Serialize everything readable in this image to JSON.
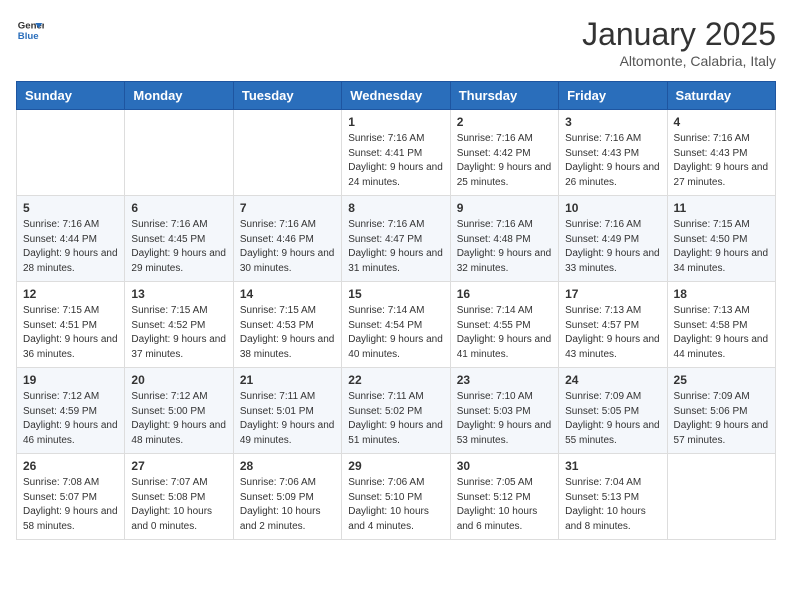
{
  "logo": {
    "line1": "General",
    "line2": "Blue"
  },
  "title": "January 2025",
  "subtitle": "Altomonte, Calabria, Italy",
  "weekdays": [
    "Sunday",
    "Monday",
    "Tuesday",
    "Wednesday",
    "Thursday",
    "Friday",
    "Saturday"
  ],
  "weeks": [
    [
      {
        "day": "",
        "sunrise": "",
        "sunset": "",
        "daylight": ""
      },
      {
        "day": "",
        "sunrise": "",
        "sunset": "",
        "daylight": ""
      },
      {
        "day": "",
        "sunrise": "",
        "sunset": "",
        "daylight": ""
      },
      {
        "day": "1",
        "sunrise": "Sunrise: 7:16 AM",
        "sunset": "Sunset: 4:41 PM",
        "daylight": "Daylight: 9 hours and 24 minutes."
      },
      {
        "day": "2",
        "sunrise": "Sunrise: 7:16 AM",
        "sunset": "Sunset: 4:42 PM",
        "daylight": "Daylight: 9 hours and 25 minutes."
      },
      {
        "day": "3",
        "sunrise": "Sunrise: 7:16 AM",
        "sunset": "Sunset: 4:43 PM",
        "daylight": "Daylight: 9 hours and 26 minutes."
      },
      {
        "day": "4",
        "sunrise": "Sunrise: 7:16 AM",
        "sunset": "Sunset: 4:43 PM",
        "daylight": "Daylight: 9 hours and 27 minutes."
      }
    ],
    [
      {
        "day": "5",
        "sunrise": "Sunrise: 7:16 AM",
        "sunset": "Sunset: 4:44 PM",
        "daylight": "Daylight: 9 hours and 28 minutes."
      },
      {
        "day": "6",
        "sunrise": "Sunrise: 7:16 AM",
        "sunset": "Sunset: 4:45 PM",
        "daylight": "Daylight: 9 hours and 29 minutes."
      },
      {
        "day": "7",
        "sunrise": "Sunrise: 7:16 AM",
        "sunset": "Sunset: 4:46 PM",
        "daylight": "Daylight: 9 hours and 30 minutes."
      },
      {
        "day": "8",
        "sunrise": "Sunrise: 7:16 AM",
        "sunset": "Sunset: 4:47 PM",
        "daylight": "Daylight: 9 hours and 31 minutes."
      },
      {
        "day": "9",
        "sunrise": "Sunrise: 7:16 AM",
        "sunset": "Sunset: 4:48 PM",
        "daylight": "Daylight: 9 hours and 32 minutes."
      },
      {
        "day": "10",
        "sunrise": "Sunrise: 7:16 AM",
        "sunset": "Sunset: 4:49 PM",
        "daylight": "Daylight: 9 hours and 33 minutes."
      },
      {
        "day": "11",
        "sunrise": "Sunrise: 7:15 AM",
        "sunset": "Sunset: 4:50 PM",
        "daylight": "Daylight: 9 hours and 34 minutes."
      }
    ],
    [
      {
        "day": "12",
        "sunrise": "Sunrise: 7:15 AM",
        "sunset": "Sunset: 4:51 PM",
        "daylight": "Daylight: 9 hours and 36 minutes."
      },
      {
        "day": "13",
        "sunrise": "Sunrise: 7:15 AM",
        "sunset": "Sunset: 4:52 PM",
        "daylight": "Daylight: 9 hours and 37 minutes."
      },
      {
        "day": "14",
        "sunrise": "Sunrise: 7:15 AM",
        "sunset": "Sunset: 4:53 PM",
        "daylight": "Daylight: 9 hours and 38 minutes."
      },
      {
        "day": "15",
        "sunrise": "Sunrise: 7:14 AM",
        "sunset": "Sunset: 4:54 PM",
        "daylight": "Daylight: 9 hours and 40 minutes."
      },
      {
        "day": "16",
        "sunrise": "Sunrise: 7:14 AM",
        "sunset": "Sunset: 4:55 PM",
        "daylight": "Daylight: 9 hours and 41 minutes."
      },
      {
        "day": "17",
        "sunrise": "Sunrise: 7:13 AM",
        "sunset": "Sunset: 4:57 PM",
        "daylight": "Daylight: 9 hours and 43 minutes."
      },
      {
        "day": "18",
        "sunrise": "Sunrise: 7:13 AM",
        "sunset": "Sunset: 4:58 PM",
        "daylight": "Daylight: 9 hours and 44 minutes."
      }
    ],
    [
      {
        "day": "19",
        "sunrise": "Sunrise: 7:12 AM",
        "sunset": "Sunset: 4:59 PM",
        "daylight": "Daylight: 9 hours and 46 minutes."
      },
      {
        "day": "20",
        "sunrise": "Sunrise: 7:12 AM",
        "sunset": "Sunset: 5:00 PM",
        "daylight": "Daylight: 9 hours and 48 minutes."
      },
      {
        "day": "21",
        "sunrise": "Sunrise: 7:11 AM",
        "sunset": "Sunset: 5:01 PM",
        "daylight": "Daylight: 9 hours and 49 minutes."
      },
      {
        "day": "22",
        "sunrise": "Sunrise: 7:11 AM",
        "sunset": "Sunset: 5:02 PM",
        "daylight": "Daylight: 9 hours and 51 minutes."
      },
      {
        "day": "23",
        "sunrise": "Sunrise: 7:10 AM",
        "sunset": "Sunset: 5:03 PM",
        "daylight": "Daylight: 9 hours and 53 minutes."
      },
      {
        "day": "24",
        "sunrise": "Sunrise: 7:09 AM",
        "sunset": "Sunset: 5:05 PM",
        "daylight": "Daylight: 9 hours and 55 minutes."
      },
      {
        "day": "25",
        "sunrise": "Sunrise: 7:09 AM",
        "sunset": "Sunset: 5:06 PM",
        "daylight": "Daylight: 9 hours and 57 minutes."
      }
    ],
    [
      {
        "day": "26",
        "sunrise": "Sunrise: 7:08 AM",
        "sunset": "Sunset: 5:07 PM",
        "daylight": "Daylight: 9 hours and 58 minutes."
      },
      {
        "day": "27",
        "sunrise": "Sunrise: 7:07 AM",
        "sunset": "Sunset: 5:08 PM",
        "daylight": "Daylight: 10 hours and 0 minutes."
      },
      {
        "day": "28",
        "sunrise": "Sunrise: 7:06 AM",
        "sunset": "Sunset: 5:09 PM",
        "daylight": "Daylight: 10 hours and 2 minutes."
      },
      {
        "day": "29",
        "sunrise": "Sunrise: 7:06 AM",
        "sunset": "Sunset: 5:10 PM",
        "daylight": "Daylight: 10 hours and 4 minutes."
      },
      {
        "day": "30",
        "sunrise": "Sunrise: 7:05 AM",
        "sunset": "Sunset: 5:12 PM",
        "daylight": "Daylight: 10 hours and 6 minutes."
      },
      {
        "day": "31",
        "sunrise": "Sunrise: 7:04 AM",
        "sunset": "Sunset: 5:13 PM",
        "daylight": "Daylight: 10 hours and 8 minutes."
      },
      {
        "day": "",
        "sunrise": "",
        "sunset": "",
        "daylight": ""
      }
    ]
  ]
}
